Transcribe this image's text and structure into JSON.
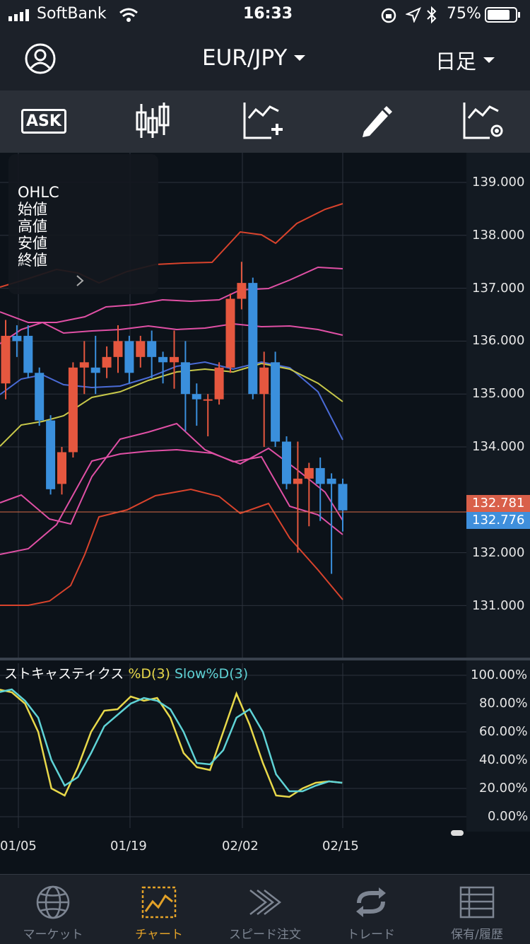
{
  "status": {
    "carrier": "SoftBank",
    "time": "16:33",
    "battery": "75%"
  },
  "nav": {
    "pair": "EUR/JPY",
    "period": "日足"
  },
  "toolbar": {
    "ask_label": "ASK"
  },
  "ohlc": {
    "title": "OHLC",
    "open": "始値",
    "high": "高値",
    "low": "安値",
    "close": "終値"
  },
  "price_axis": [
    "139.000",
    "138.000",
    "137.000",
    "136.000",
    "135.000",
    "134.000",
    "132.000",
    "131.000"
  ],
  "price_tags": {
    "ask": "132.781",
    "bid": "132.776"
  },
  "stoch": {
    "label": "ストキャスティクス",
    "k_label": "%D(3)",
    "d_label": "Slow%D(3)",
    "axis": [
      "100.00%",
      "80.00%",
      "60.00%",
      "40.00%",
      "20.00%",
      "0.00%"
    ]
  },
  "x_axis": [
    "01/05",
    "01/19",
    "02/02",
    "02/15"
  ],
  "tabs": [
    "マーケット",
    "チャート",
    "スピード注文",
    "トレード",
    "保有/履歴"
  ],
  "chart_data": {
    "type": "candlestick",
    "ylim": [
      130.0,
      139.5
    ],
    "candles": [
      {
        "o": 135.2,
        "h": 136.4,
        "l": 134.9,
        "c": 136.1
      },
      {
        "o": 136.1,
        "h": 136.3,
        "l": 135.7,
        "c": 136.0
      },
      {
        "o": 136.1,
        "h": 136.3,
        "l": 135.3,
        "c": 135.4
      },
      {
        "o": 135.4,
        "h": 135.5,
        "l": 134.4,
        "c": 134.5
      },
      {
        "o": 134.5,
        "h": 134.6,
        "l": 133.1,
        "c": 133.2
      },
      {
        "o": 133.3,
        "h": 134.0,
        "l": 133.1,
        "c": 133.9
      },
      {
        "o": 133.9,
        "h": 135.6,
        "l": 133.8,
        "c": 135.5
      },
      {
        "o": 135.5,
        "h": 136.0,
        "l": 135.0,
        "c": 135.6
      },
      {
        "o": 135.5,
        "h": 136.1,
        "l": 135.0,
        "c": 135.4
      },
      {
        "o": 135.5,
        "h": 135.9,
        "l": 135.3,
        "c": 135.7
      },
      {
        "o": 135.7,
        "h": 136.3,
        "l": 135.4,
        "c": 136.0
      },
      {
        "o": 136.0,
        "h": 136.1,
        "l": 135.2,
        "c": 135.4
      },
      {
        "o": 135.7,
        "h": 136.1,
        "l": 135.5,
        "c": 136.0
      },
      {
        "o": 136.0,
        "h": 136.2,
        "l": 135.3,
        "c": 135.7
      },
      {
        "o": 135.7,
        "h": 135.8,
        "l": 135.2,
        "c": 135.6
      },
      {
        "o": 135.6,
        "h": 136.2,
        "l": 135.1,
        "c": 135.7
      },
      {
        "o": 135.6,
        "h": 136.0,
        "l": 134.3,
        "c": 135.0
      },
      {
        "o": 135.0,
        "h": 135.2,
        "l": 134.4,
        "c": 134.9
      },
      {
        "o": 134.9,
        "h": 135.0,
        "l": 134.2,
        "c": 134.9
      },
      {
        "o": 134.9,
        "h": 135.6,
        "l": 134.8,
        "c": 135.5
      },
      {
        "o": 135.5,
        "h": 136.9,
        "l": 135.4,
        "c": 136.8
      },
      {
        "o": 136.8,
        "h": 137.5,
        "l": 136.6,
        "c": 137.1
      },
      {
        "o": 137.1,
        "h": 137.2,
        "l": 134.9,
        "c": 135.0
      },
      {
        "o": 135.0,
        "h": 135.8,
        "l": 134.0,
        "c": 135.5
      },
      {
        "o": 135.6,
        "h": 135.8,
        "l": 134.0,
        "c": 134.1
      },
      {
        "o": 134.1,
        "h": 134.2,
        "l": 133.2,
        "c": 133.3
      },
      {
        "o": 133.3,
        "h": 134.1,
        "l": 132.0,
        "c": 133.4
      },
      {
        "o": 133.4,
        "h": 133.7,
        "l": 132.5,
        "c": 133.6
      },
      {
        "o": 133.6,
        "h": 133.8,
        "l": 132.6,
        "c": 133.3
      },
      {
        "o": 133.4,
        "h": 133.5,
        "l": 131.6,
        "c": 133.3
      },
      {
        "o": 133.3,
        "h": 133.4,
        "l": 132.4,
        "c": 132.8
      }
    ]
  }
}
